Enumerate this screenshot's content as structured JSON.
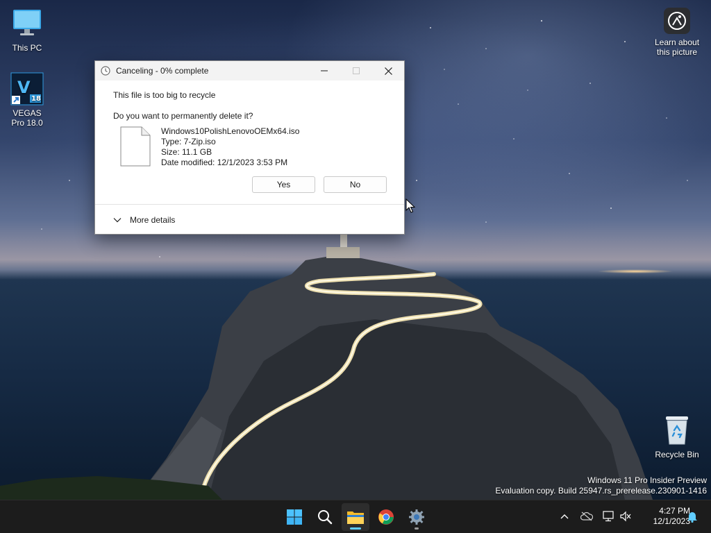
{
  "desktop": {
    "icons": [
      {
        "label": "This PC"
      },
      {
        "label": "VEGAS Pro 18.0",
        "badge": "18"
      },
      {
        "label": "Learn about this picture"
      },
      {
        "label": "Recycle Bin"
      }
    ],
    "watermark": {
      "line1": "Windows 11 Pro Insider Preview",
      "line2": "Evaluation copy. Build 25947.rs_prerelease.230901-1416"
    }
  },
  "dialog": {
    "title": "Canceling - 0% complete",
    "message": "This file is too big to recycle",
    "question": "Do you want to permanently delete it?",
    "file": {
      "name": "Windows10PolishLenovoOEMx64.iso",
      "type": "Type: 7-Zip.iso",
      "size": "Size: 11.1 GB",
      "modified": "Date modified: 12/1/2023 3:53 PM"
    },
    "yes_label": "Yes",
    "no_label": "No",
    "more_details_label": "More details"
  },
  "taskbar": {
    "apps": [
      "start",
      "search",
      "file-explorer",
      "chrome",
      "settings"
    ],
    "time": "4:27 PM",
    "date": "12/1/2023"
  },
  "colors": {
    "accent": "#60cdff",
    "taskbar": "#1c1c1c",
    "dialog_titlebar": "#f3f3f3"
  }
}
